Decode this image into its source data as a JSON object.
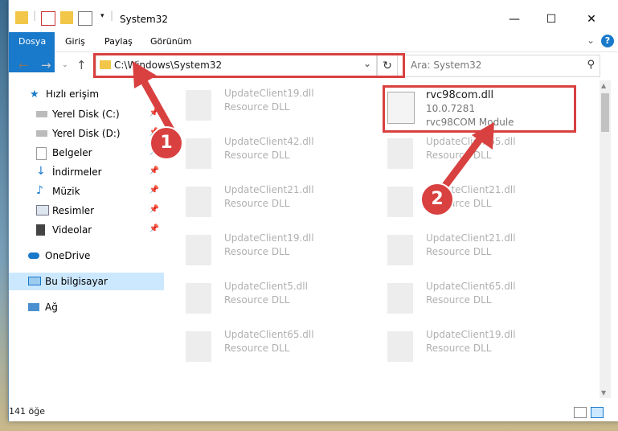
{
  "window": {
    "title": "System32"
  },
  "ribbon": {
    "tabs": [
      "Dosya",
      "Giriş",
      "Paylaş",
      "Görünüm"
    ],
    "help_label": "?"
  },
  "nav": {
    "address": "C:\\Windows\\System32",
    "search_placeholder": "Ara: System32"
  },
  "sidebar": {
    "items": [
      {
        "label": "Hızlı erişim",
        "icon": "star-icon"
      },
      {
        "label": "Yerel Disk (C:)",
        "icon": "drive-icon",
        "pinned": true
      },
      {
        "label": "Yerel Disk (D:)",
        "icon": "drive-icon",
        "pinned": true
      },
      {
        "label": "Belgeler",
        "icon": "documents-icon",
        "pinned": true
      },
      {
        "label": "İndirmeler",
        "icon": "download-icon",
        "pinned": true
      },
      {
        "label": "Müzik",
        "icon": "music-icon",
        "pinned": true
      },
      {
        "label": "Resimler",
        "icon": "pictures-icon",
        "pinned": true
      },
      {
        "label": "Videolar",
        "icon": "videos-icon",
        "pinned": true
      },
      {
        "label": "OneDrive",
        "icon": "cloud-icon"
      },
      {
        "label": "Bu bilgisayar",
        "icon": "computer-icon",
        "selected": true
      },
      {
        "label": "Ağ",
        "icon": "network-icon"
      }
    ]
  },
  "files": {
    "highlighted": {
      "name": "rvc98com.dll",
      "version": "10.0.7281",
      "description": "rvc98COM Module"
    },
    "left": [
      {
        "name": "UpdateClient19.dll",
        "type": "Resource DLL"
      },
      {
        "name": "UpdateClient42.dll",
        "type": "Resource DLL"
      },
      {
        "name": "UpdateClient21.dll",
        "type": "Resource DLL"
      },
      {
        "name": "UpdateClient19.dll",
        "type": "Resource DLL"
      },
      {
        "name": "UpdateClient5.dll",
        "type": "Resource DLL"
      },
      {
        "name": "UpdateClient65.dll",
        "type": "Resource DLL"
      }
    ],
    "right": [
      {
        "name": "UpdateClient65.dll",
        "type": "Resource DLL"
      },
      {
        "name": "UpdateClient21.dll",
        "type": "Resource DLL"
      },
      {
        "name": "UpdateClient21.dll",
        "type": "Resource DLL"
      },
      {
        "name": "UpdateClient65.dll",
        "type": "Resource DLL"
      },
      {
        "name": "UpdateClient19.dll",
        "type": "Resource DLL"
      }
    ]
  },
  "status": {
    "count": "141 öğe"
  },
  "annotations": {
    "step1": "1",
    "step2": "2"
  },
  "colors": {
    "accent": "#1979ca",
    "highlight": "#d94040",
    "selected": "#cce8ff"
  }
}
